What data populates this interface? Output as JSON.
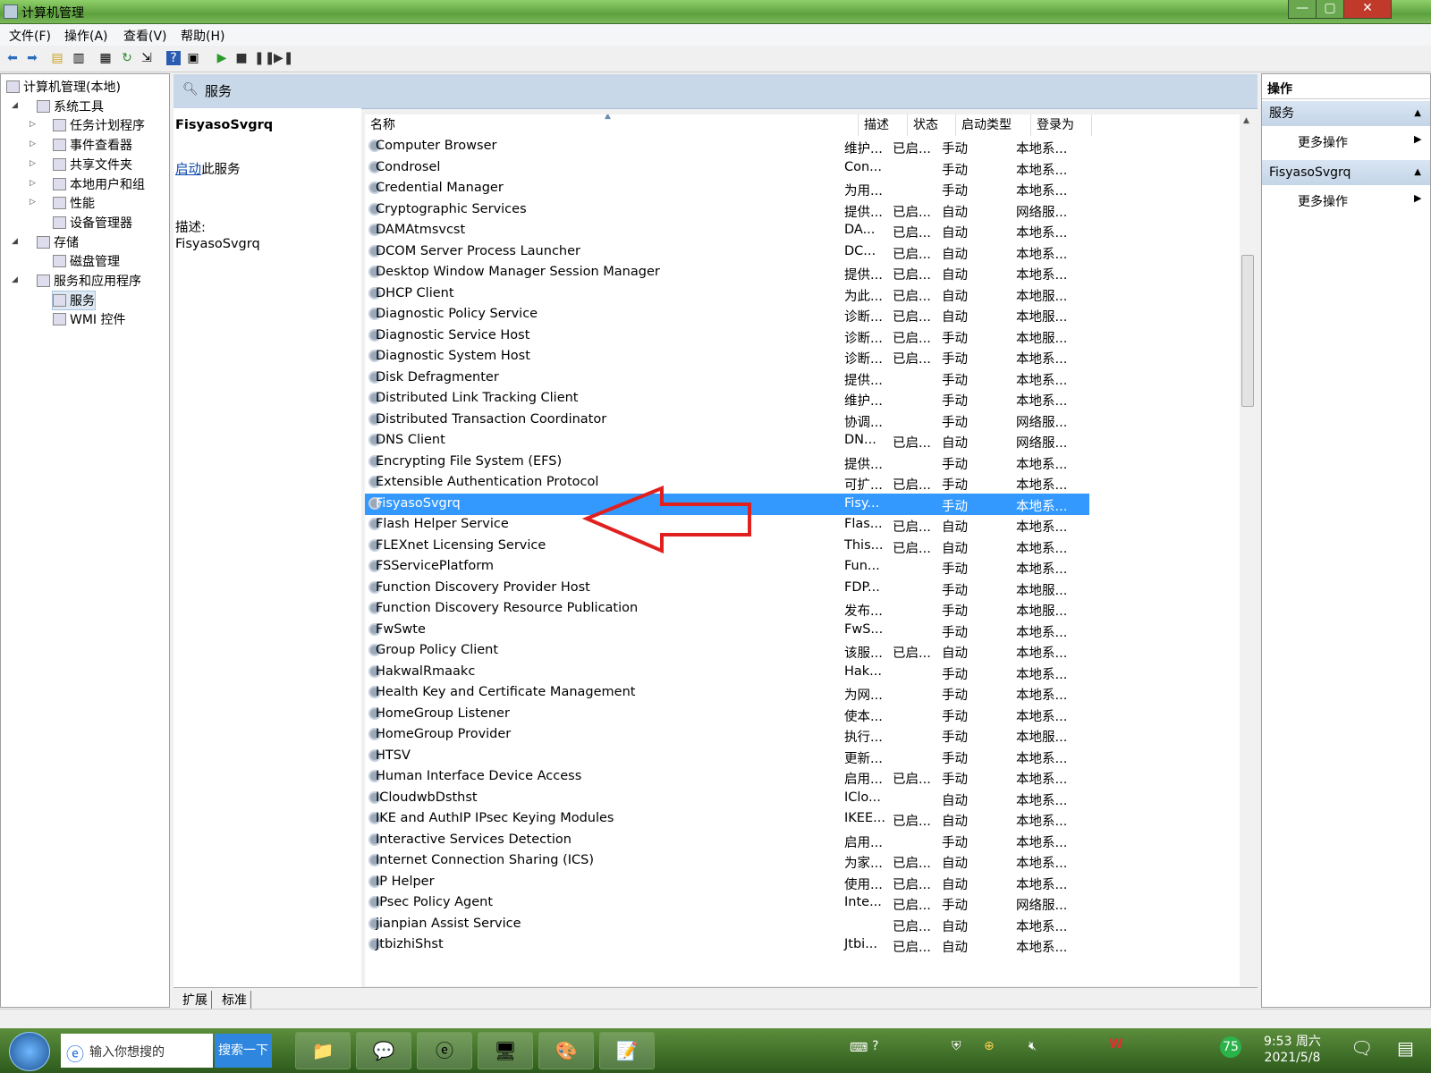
{
  "window": {
    "title": "计算机管理",
    "controls": [
      "—",
      "▢",
      "✕"
    ]
  },
  "menu": [
    "文件(F)",
    "操作(A)",
    "查看(V)",
    "帮助(H)"
  ],
  "tree": [
    {
      "label": "计算机管理(本地)",
      "level": 0,
      "expander": ""
    },
    {
      "label": "系统工具",
      "level": 1,
      "expander": "◢"
    },
    {
      "label": "任务计划程序",
      "level": 2,
      "expander": "▷"
    },
    {
      "label": "事件查看器",
      "level": 2,
      "expander": "▷"
    },
    {
      "label": "共享文件夹",
      "level": 2,
      "expander": "▷"
    },
    {
      "label": "本地用户和组",
      "level": 2,
      "expander": "▷"
    },
    {
      "label": "性能",
      "level": 2,
      "expander": "▷"
    },
    {
      "label": "设备管理器",
      "level": 2,
      "expander": ""
    },
    {
      "label": "存储",
      "level": 1,
      "expander": "◢"
    },
    {
      "label": "磁盘管理",
      "level": 2,
      "expander": ""
    },
    {
      "label": "服务和应用程序",
      "level": 1,
      "expander": "◢"
    },
    {
      "label": "服务",
      "level": 2,
      "expander": "",
      "selected": true
    },
    {
      "label": "WMI 控件",
      "level": 2,
      "expander": ""
    }
  ],
  "center": {
    "header": "服务",
    "detail": {
      "service_name": "FisyasoSvgrq",
      "start_link": "启动",
      "start_suffix": "此服务",
      "desc_label": "描述:",
      "desc_value": "FisyasoSvgrq"
    },
    "columns": [
      "名称",
      "描述",
      "状态",
      "启动类型",
      "登录为"
    ],
    "rows": [
      {
        "name": "Computer Browser",
        "desc": "维护...",
        "status": "已启...",
        "startup": "手动",
        "logon": "本地系..."
      },
      {
        "name": "Condrosel",
        "desc": "Con...",
        "status": "",
        "startup": "手动",
        "logon": "本地系..."
      },
      {
        "name": "Credential Manager",
        "desc": "为用...",
        "status": "",
        "startup": "手动",
        "logon": "本地系..."
      },
      {
        "name": "Cryptographic Services",
        "desc": "提供...",
        "status": "已启...",
        "startup": "自动",
        "logon": "网络服..."
      },
      {
        "name": "DAMAtmsvcst",
        "desc": "DA...",
        "status": "已启...",
        "startup": "自动",
        "logon": "本地系..."
      },
      {
        "name": "DCOM Server Process Launcher",
        "desc": "DC...",
        "status": "已启...",
        "startup": "自动",
        "logon": "本地系..."
      },
      {
        "name": "Desktop Window Manager Session Manager",
        "desc": "提供...",
        "status": "已启...",
        "startup": "自动",
        "logon": "本地系..."
      },
      {
        "name": "DHCP Client",
        "desc": "为此...",
        "status": "已启...",
        "startup": "自动",
        "logon": "本地服..."
      },
      {
        "name": "Diagnostic Policy Service",
        "desc": "诊断...",
        "status": "已启...",
        "startup": "自动",
        "logon": "本地服..."
      },
      {
        "name": "Diagnostic Service Host",
        "desc": "诊断...",
        "status": "已启...",
        "startup": "手动",
        "logon": "本地服..."
      },
      {
        "name": "Diagnostic System Host",
        "desc": "诊断...",
        "status": "已启...",
        "startup": "手动",
        "logon": "本地系..."
      },
      {
        "name": "Disk Defragmenter",
        "desc": "提供...",
        "status": "",
        "startup": "手动",
        "logon": "本地系..."
      },
      {
        "name": "Distributed Link Tracking Client",
        "desc": "维护...",
        "status": "",
        "startup": "手动",
        "logon": "本地系..."
      },
      {
        "name": "Distributed Transaction Coordinator",
        "desc": "协调...",
        "status": "",
        "startup": "手动",
        "logon": "网络服..."
      },
      {
        "name": "DNS Client",
        "desc": "DN...",
        "status": "已启...",
        "startup": "自动",
        "logon": "网络服..."
      },
      {
        "name": "Encrypting File System (EFS)",
        "desc": "提供...",
        "status": "",
        "startup": "手动",
        "logon": "本地系..."
      },
      {
        "name": "Extensible Authentication Protocol",
        "desc": "可扩...",
        "status": "已启...",
        "startup": "手动",
        "logon": "本地系..."
      },
      {
        "name": "FisyasoSvgrq",
        "desc": "Fisy...",
        "status": "",
        "startup": "手动",
        "logon": "本地系...",
        "selected": true
      },
      {
        "name": "Flash Helper Service",
        "desc": "Flas...",
        "status": "已启...",
        "startup": "自动",
        "logon": "本地系..."
      },
      {
        "name": "FLEXnet Licensing Service",
        "desc": "This...",
        "status": "已启...",
        "startup": "自动",
        "logon": "本地系..."
      },
      {
        "name": "FSServicePlatform",
        "desc": "Fun...",
        "status": "",
        "startup": "手动",
        "logon": "本地系..."
      },
      {
        "name": "Function Discovery Provider Host",
        "desc": "FDP...",
        "status": "",
        "startup": "手动",
        "logon": "本地服..."
      },
      {
        "name": "Function Discovery Resource Publication",
        "desc": "发布...",
        "status": "",
        "startup": "手动",
        "logon": "本地服..."
      },
      {
        "name": "FwSwte",
        "desc": "FwS...",
        "status": "",
        "startup": "手动",
        "logon": "本地系..."
      },
      {
        "name": "Group Policy Client",
        "desc": "该服...",
        "status": "已启...",
        "startup": "自动",
        "logon": "本地系..."
      },
      {
        "name": "HakwalRmaakc",
        "desc": "Hak...",
        "status": "",
        "startup": "手动",
        "logon": "本地系..."
      },
      {
        "name": "Health Key and Certificate Management",
        "desc": "为网...",
        "status": "",
        "startup": "手动",
        "logon": "本地系..."
      },
      {
        "name": "HomeGroup Listener",
        "desc": "使本...",
        "status": "",
        "startup": "手动",
        "logon": "本地系..."
      },
      {
        "name": "HomeGroup Provider",
        "desc": "执行...",
        "status": "",
        "startup": "手动",
        "logon": "本地服..."
      },
      {
        "name": "HTSV",
        "desc": "更新...",
        "status": "",
        "startup": "手动",
        "logon": "本地系..."
      },
      {
        "name": "Human Interface Device Access",
        "desc": "启用...",
        "status": "已启...",
        "startup": "手动",
        "logon": "本地系..."
      },
      {
        "name": "ICloudwbDsthst",
        "desc": "IClo...",
        "status": "",
        "startup": "自动",
        "logon": "本地系..."
      },
      {
        "name": "IKE and AuthIP IPsec Keying Modules",
        "desc": "IKEE...",
        "status": "已启...",
        "startup": "自动",
        "logon": "本地系..."
      },
      {
        "name": "Interactive Services Detection",
        "desc": "启用...",
        "status": "",
        "startup": "手动",
        "logon": "本地系..."
      },
      {
        "name": "Internet Connection Sharing (ICS)",
        "desc": "为家...",
        "status": "已启...",
        "startup": "自动",
        "logon": "本地系..."
      },
      {
        "name": "IP Helper",
        "desc": "使用...",
        "status": "已启...",
        "startup": "自动",
        "logon": "本地系..."
      },
      {
        "name": "IPsec Policy Agent",
        "desc": "Inte...",
        "status": "已启...",
        "startup": "手动",
        "logon": "网络服..."
      },
      {
        "name": "jianpian Assist Service",
        "desc": "",
        "status": "已启...",
        "startup": "自动",
        "logon": "本地系..."
      },
      {
        "name": "JtbizhiShst",
        "desc": "Jtbi...",
        "status": "已启...",
        "startup": "自动",
        "logon": "本地系..."
      }
    ],
    "tabs": [
      "扩展",
      "标准"
    ]
  },
  "actions": {
    "title": "操作",
    "sections": [
      {
        "header": "服务",
        "item": "更多操作"
      },
      {
        "header": "FisyasoSvgrq",
        "item": "更多操作"
      }
    ]
  },
  "taskbar": {
    "search_placeholder": "输入你想搜的",
    "search_button": "搜索一下",
    "clock_time": "9:53 周六",
    "clock_date": "2021/5/8",
    "badge": "75"
  },
  "colors": {
    "selection": "#3399ff",
    "arrow": "#e0201f",
    "link": "#0645ad"
  }
}
